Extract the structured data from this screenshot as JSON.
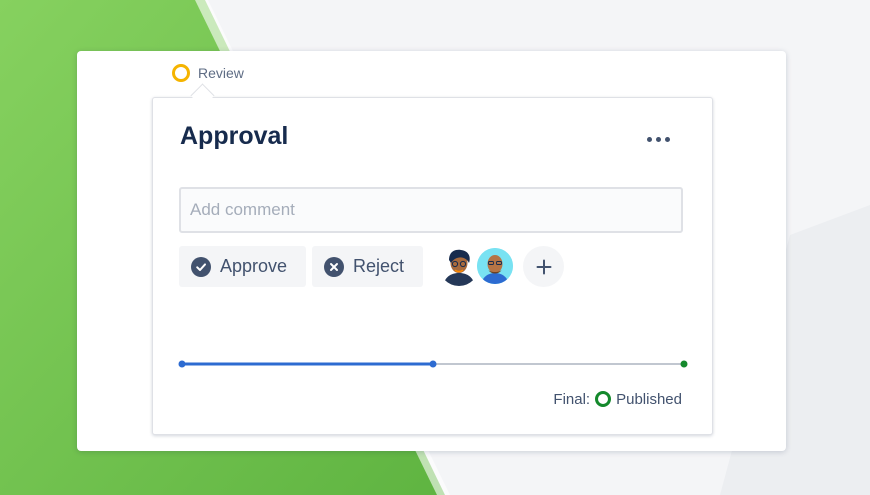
{
  "status": {
    "label": "Review",
    "color": "#f5b400"
  },
  "card": {
    "title": "Approval",
    "comment_placeholder": "Add comment",
    "approve_label": "Approve",
    "reject_label": "Reject",
    "progress_fraction": 0.5,
    "final_prefix": "Final:",
    "final_status": "Published",
    "final_color": "#14892c"
  },
  "colors": {
    "background_green": "#74c35a",
    "progress_blue": "#2d6bd1",
    "progress_track": "#c1c7d0"
  }
}
